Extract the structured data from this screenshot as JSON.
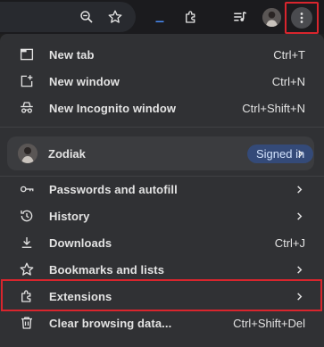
{
  "toolbar": {
    "icons": [
      "zoom-icon",
      "bookmark-star-icon",
      "extension-pin-icon",
      "puzzle-icon",
      "media-queue-icon",
      "profile-avatar",
      "more-menu-icon"
    ]
  },
  "menu": {
    "new_tab": {
      "label": "New tab",
      "shortcut": "Ctrl+T"
    },
    "new_window": {
      "label": "New window",
      "shortcut": "Ctrl+N"
    },
    "new_incognito": {
      "label": "New Incognito window",
      "shortcut": "Ctrl+Shift+N"
    },
    "profile": {
      "name": "Zodiak",
      "status": "Signed in"
    },
    "passwords": {
      "label": "Passwords and autofill"
    },
    "history": {
      "label": "History"
    },
    "downloads": {
      "label": "Downloads",
      "shortcut": "Ctrl+J"
    },
    "bookmarks": {
      "label": "Bookmarks and lists"
    },
    "extensions": {
      "label": "Extensions"
    },
    "clear_data": {
      "label": "Clear browsing data...",
      "shortcut": "Ctrl+Shift+Del"
    }
  },
  "colors": {
    "highlight": "#d9252d",
    "menu_bg": "#303134",
    "badge_bg": "#344a78"
  }
}
